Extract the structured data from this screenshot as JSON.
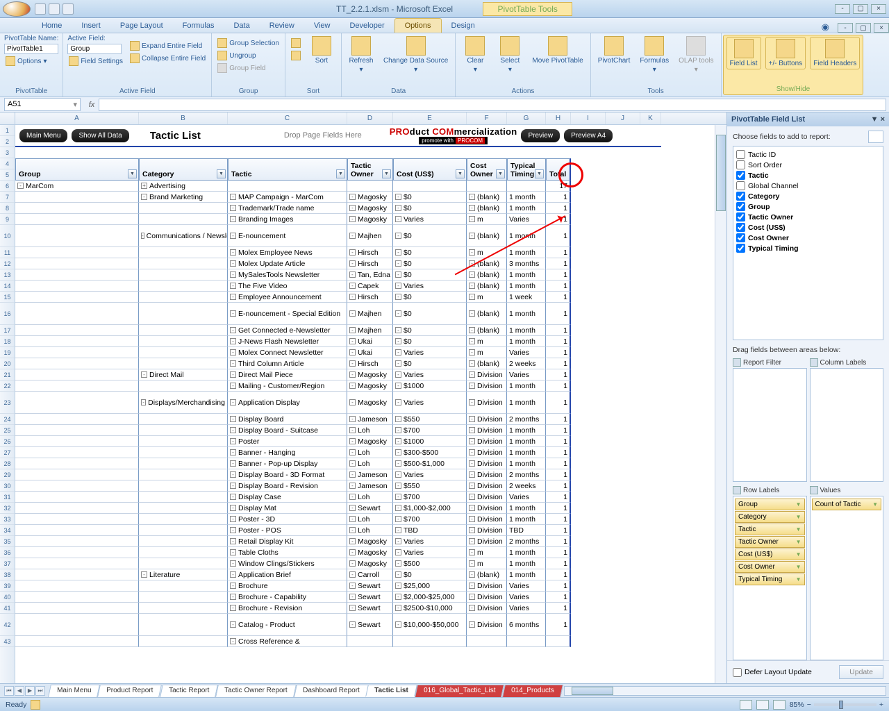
{
  "title": "TT_2.2.1.xlsm - Microsoft Excel",
  "context_title": "PivotTable Tools",
  "tabs": [
    "Home",
    "Insert",
    "Page Layout",
    "Formulas",
    "Data",
    "Review",
    "View",
    "Developer",
    "Options",
    "Design"
  ],
  "active_tab": "Options",
  "ribbon": {
    "pt_name_label": "PivotTable Name:",
    "pt_name": "PivotTable1",
    "options_btn": "Options",
    "g_pivottable": "PivotTable",
    "active_field_label": "Active Field:",
    "active_field": "Group",
    "field_settings": "Field Settings",
    "expand": "Expand Entire Field",
    "collapse": "Collapse Entire Field",
    "g_activefield": "Active Field",
    "group_selection": "Group Selection",
    "ungroup": "Ungroup",
    "group_field": "Group Field",
    "g_group": "Group",
    "sort": "Sort",
    "g_sort": "Sort",
    "refresh": "Refresh",
    "change_ds": "Change Data Source",
    "g_data": "Data",
    "clear": "Clear",
    "select": "Select",
    "move": "Move PivotTable",
    "g_actions": "Actions",
    "pivotchart": "PivotChart",
    "formulas": "Formulas",
    "olap": "OLAP tools",
    "g_tools": "Tools",
    "fieldlist": "Field List",
    "pmbuttons": "+/- Buttons",
    "fieldheaders": "Field Headers",
    "g_showhide": "Show/Hide"
  },
  "namebox": "A51",
  "columns": [
    "A",
    "B",
    "C",
    "D",
    "E",
    "F",
    "G",
    "H",
    "I",
    "J",
    "K"
  ],
  "page_title": "Tactic List",
  "btn_main": "Main Menu",
  "btn_showall": "Show All Data",
  "pagefields": "Drop Page Fields Here",
  "procom_l1a": "PRO",
  "procom_l1b": "duct ",
  "procom_l1c": "COM",
  "procom_l1d": "mercialization",
  "procom_l2a": "promote with",
  "procom_l2b": "PROCOM",
  "btn_preview": "Preview",
  "btn_preview_a4": "Preview A4",
  "headers": [
    "Group",
    "Category",
    "Tactic",
    "Tactic Owner",
    "Cost (US$)",
    "Cost Owner",
    "Typical Timing",
    "Total"
  ],
  "rows": [
    {
      "r": 6,
      "a": "MarCom",
      "ax": "-",
      "b": "Advertising",
      "bx": "+",
      "t": "17"
    },
    {
      "r": 7,
      "b": "Brand Marketing",
      "bx": "-",
      "c": "MAP Campaign - MarCom",
      "d": "Magosky",
      "e": "$0",
      "f": "(blank)",
      "g": "1 month",
      "t": "1"
    },
    {
      "r": 8,
      "c": "Trademark/Trade name",
      "d": "Magosky",
      "e": "$0",
      "f": "(blank)",
      "g": "1 month",
      "t": "1"
    },
    {
      "r": 9,
      "c": "Branding Images",
      "d": "Magosky",
      "e": "Varies",
      "f": "m",
      "g": "Varies",
      "t": "1"
    },
    {
      "r": 10,
      "tall": true,
      "b": "Communications / Newsletter",
      "bx": "-",
      "c": "E-nouncement",
      "d": "Majhen",
      "e": "$0",
      "f": "(blank)",
      "g": "1 month",
      "t": "1"
    },
    {
      "r": 11,
      "c": "Molex Employee News",
      "d": "Hirsch",
      "e": "$0",
      "f": "m",
      "g": "1 month",
      "t": "1"
    },
    {
      "r": 12,
      "c": "Molex Update Article",
      "d": "Hirsch",
      "e": "$0",
      "f": "(blank)",
      "g": "3 months",
      "t": "1"
    },
    {
      "r": 13,
      "c": "MySalesTools Newsletter",
      "d": "Tan, Edna",
      "e": "$0",
      "f": "(blank)",
      "g": "1 month",
      "t": "1"
    },
    {
      "r": 14,
      "c": "The Five Video",
      "d": "Capek",
      "e": "Varies",
      "f": "(blank)",
      "g": "1 month",
      "t": "1"
    },
    {
      "r": 15,
      "c": "Employee Announcement",
      "d": "Hirsch",
      "e": "$0",
      "f": "m",
      "g": "1 week",
      "t": "1"
    },
    {
      "r": 16,
      "tall": true,
      "c": "E-nouncement - Special Edition",
      "d": "Majhen",
      "e": "$0",
      "f": "(blank)",
      "g": "1 month",
      "t": "1"
    },
    {
      "r": 17,
      "c": "Get Connected e-Newsletter",
      "d": "Majhen",
      "e": "$0",
      "f": "(blank)",
      "g": "1 month",
      "t": "1"
    },
    {
      "r": 18,
      "c": "J-News Flash Newsletter",
      "d": "Ukai",
      "e": "$0",
      "f": "m",
      "g": "1 month",
      "t": "1"
    },
    {
      "r": 19,
      "c": "Molex Connect Newsletter",
      "d": "Ukai",
      "e": "Varies",
      "f": "m",
      "g": "Varies",
      "t": "1"
    },
    {
      "r": 20,
      "c": "Third Column Article",
      "d": "Hirsch",
      "e": "$0",
      "f": "(blank)",
      "g": "2 weeks",
      "t": "1"
    },
    {
      "r": 21,
      "b": "Direct Mail",
      "bx": "-",
      "c": "Direct Mail Piece",
      "d": "Magosky",
      "e": "Varies",
      "f": "Division",
      "g": "Varies",
      "t": "1"
    },
    {
      "r": 22,
      "c": "Mailing - Customer/Region",
      "d": "Magosky",
      "e": "$1000",
      "f": "Division",
      "g": "1 month",
      "t": "1"
    },
    {
      "r": 23,
      "tall": true,
      "b": "Displays/Merchandising",
      "bx": "-",
      "c": "Application Display",
      "d": "Magosky",
      "e": "Varies",
      "f": "Division",
      "g": "1 month",
      "t": "1"
    },
    {
      "r": 24,
      "c": "Display Board",
      "d": "Jameson",
      "e": "$550",
      "f": "Division",
      "g": "2 months",
      "t": "1"
    },
    {
      "r": 25,
      "c": "Display Board - Suitcase",
      "d": "Loh",
      "e": "$700",
      "f": "Division",
      "g": "1 month",
      "t": "1"
    },
    {
      "r": 26,
      "c": "Poster",
      "d": "Magosky",
      "e": "$1000",
      "f": "Division",
      "g": "1 month",
      "t": "1"
    },
    {
      "r": 27,
      "c": "Banner - Hanging",
      "d": "Loh",
      "e": "$300-$500",
      "f": "Division",
      "g": "1 month",
      "t": "1"
    },
    {
      "r": 28,
      "c": "Banner - Pop-up Display",
      "d": "Loh",
      "e": "$500-$1,000",
      "f": "Division",
      "g": "1 month",
      "t": "1"
    },
    {
      "r": 29,
      "c": "Display Board - 3D Format",
      "d": "Jameson",
      "e": "Varies",
      "f": "Division",
      "g": "2 months",
      "t": "1"
    },
    {
      "r": 30,
      "c": "Display Board - Revision",
      "d": "Jameson",
      "e": "$550",
      "f": "Division",
      "g": "2 weeks",
      "t": "1"
    },
    {
      "r": 31,
      "c": "Display Case",
      "d": "Loh",
      "e": "$700",
      "f": "Division",
      "g": "Varies",
      "t": "1"
    },
    {
      "r": 32,
      "c": "Display Mat",
      "d": "Sewart",
      "e": "$1,000-$2,000",
      "f": "Division",
      "g": "1 month",
      "t": "1"
    },
    {
      "r": 33,
      "c": "Poster - 3D",
      "d": "Loh",
      "e": "$700",
      "f": "Division",
      "g": "1 month",
      "t": "1"
    },
    {
      "r": 34,
      "c": "Poster - POS",
      "d": "Loh",
      "e": "TBD",
      "f": "Division",
      "g": "TBD",
      "t": "1"
    },
    {
      "r": 35,
      "c": "Retail Display Kit",
      "d": "Magosky",
      "e": "Varies",
      "f": "Division",
      "g": "2 months",
      "t": "1"
    },
    {
      "r": 36,
      "c": "Table Cloths",
      "d": "Magosky",
      "e": "Varies",
      "f": "m",
      "g": "1 month",
      "t": "1"
    },
    {
      "r": 37,
      "c": "Window Clings/Stickers",
      "d": "Magosky",
      "e": "$500",
      "f": "m",
      "g": "1 month",
      "t": "1"
    },
    {
      "r": 38,
      "b": "Literature",
      "bx": "-",
      "c": "Application Brief",
      "d": "Carroll",
      "e": "$0",
      "f": "(blank)",
      "g": "1 month",
      "t": "1"
    },
    {
      "r": 39,
      "c": "Brochure",
      "d": "Sewart",
      "e": "$25,000",
      "f": "Division",
      "g": "Varies",
      "t": "1"
    },
    {
      "r": 40,
      "c": "Brochure - Capability",
      "d": "Sewart",
      "e": "$2,000-$25,000",
      "f": "Division",
      "g": "Varies",
      "t": "1"
    },
    {
      "r": 41,
      "c": "Brochure - Revision",
      "d": "Sewart",
      "e": "$2500-$10,000",
      "f": "Division",
      "g": "Varies",
      "t": "1"
    },
    {
      "r": 42,
      "tall": true,
      "c": "Catalog - Product",
      "d": "Sewart",
      "e": "$10,000-$50,000",
      "f": "Division",
      "g": "6 months",
      "t": "1"
    },
    {
      "r": 43,
      "c": "Cross Reference &",
      "d": "",
      "e": "",
      "f": "",
      "g": "",
      "t": ""
    }
  ],
  "fieldlist": {
    "title": "PivotTable Field List",
    "choose": "Choose fields to add to report:",
    "fields": [
      {
        "name": "Tactic ID",
        "checked": false
      },
      {
        "name": "Sort Order",
        "checked": false
      },
      {
        "name": "Tactic",
        "checked": true,
        "bold": true
      },
      {
        "name": "Global Channel",
        "checked": false
      },
      {
        "name": "Category",
        "checked": true,
        "bold": true
      },
      {
        "name": "Group",
        "checked": true,
        "bold": true
      },
      {
        "name": "Tactic Owner",
        "checked": true,
        "bold": true
      },
      {
        "name": "Cost (US$)",
        "checked": true,
        "bold": true
      },
      {
        "name": "Cost Owner",
        "checked": true,
        "bold": true
      },
      {
        "name": "Typical Timing",
        "checked": true,
        "bold": true
      }
    ],
    "drag_label": "Drag fields between areas below:",
    "area_filter": "Report Filter",
    "area_cols": "Column Labels",
    "area_rows": "Row Labels",
    "area_vals": "Values",
    "row_chips": [
      "Group",
      "Category",
      "Tactic",
      "Tactic Owner",
      "Cost (US$)",
      "Cost Owner",
      "Typical Timing"
    ],
    "val_chips": [
      "Count of Tactic"
    ],
    "defer": "Defer Layout Update",
    "update": "Update"
  },
  "sheets": [
    {
      "name": "Main Menu"
    },
    {
      "name": "Product Report"
    },
    {
      "name": "Tactic Report"
    },
    {
      "name": "Tactic Owner Report"
    },
    {
      "name": "Dashboard Report"
    },
    {
      "name": "Tactic List",
      "active": true
    },
    {
      "name": "016_Global_Tactic_List",
      "red": true
    },
    {
      "name": "014_Products",
      "red": true
    }
  ],
  "status": {
    "ready": "Ready",
    "calc": "",
    "zoom": "85%"
  }
}
